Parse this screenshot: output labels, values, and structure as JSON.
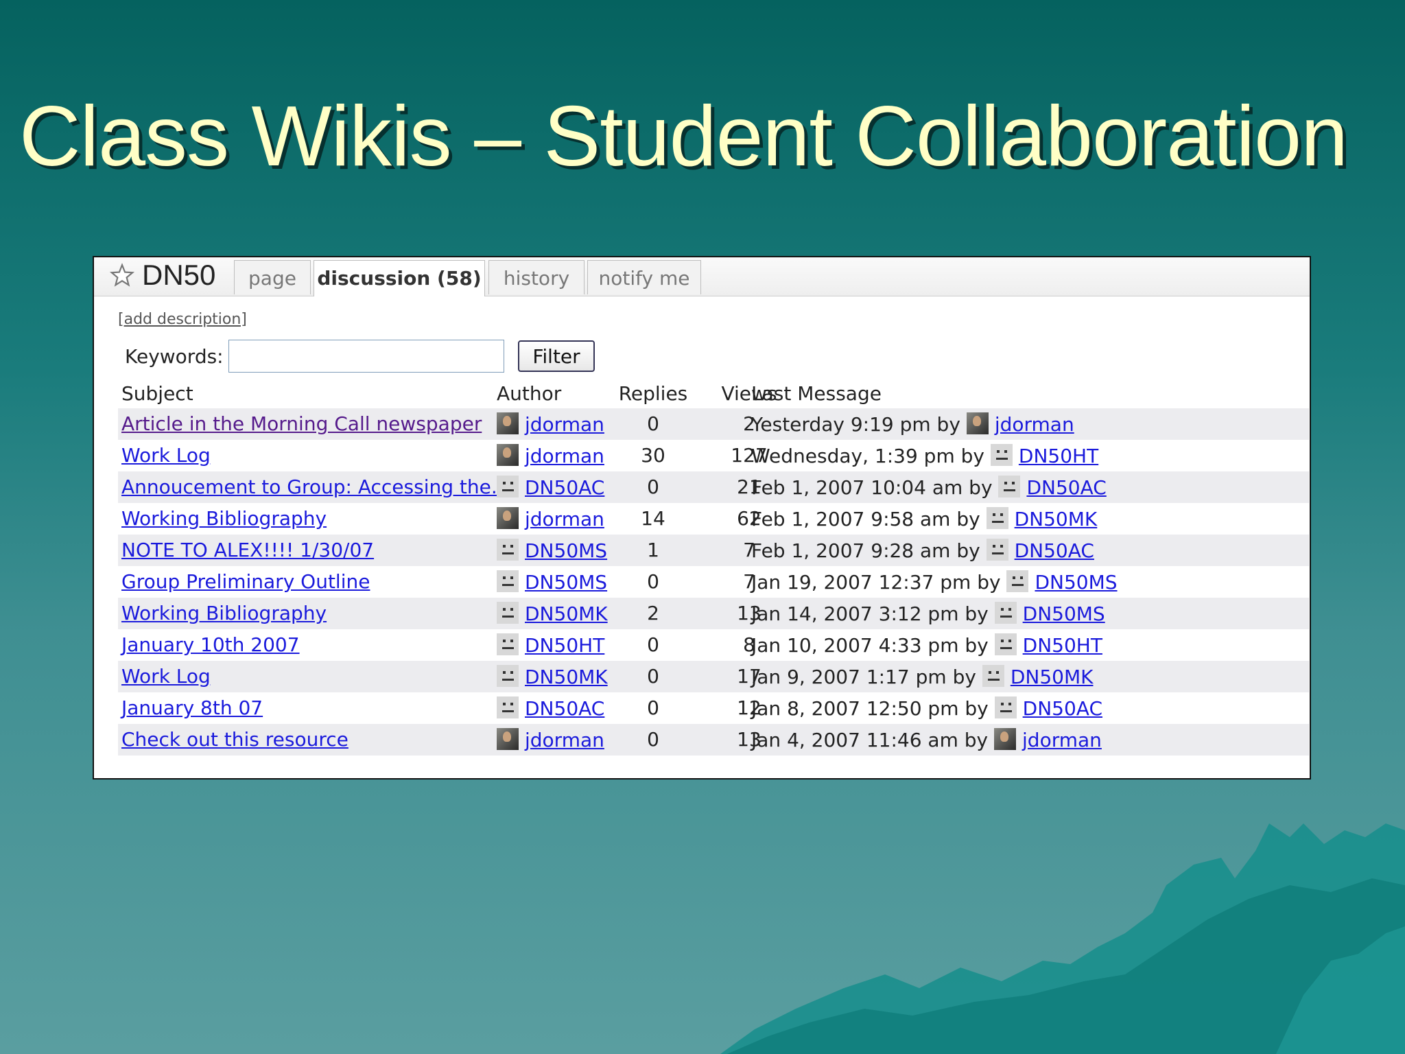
{
  "slide": {
    "title": "Class Wikis – Student Collaboration"
  },
  "wiki": {
    "page_name": "DN50",
    "tabs": [
      {
        "label": "page"
      },
      {
        "label": "discussion (58)"
      },
      {
        "label": "history"
      },
      {
        "label": "notify me"
      }
    ],
    "add_description": "[add description]",
    "filter": {
      "keywords_label": "Keywords:",
      "keywords_value": "",
      "button_label": "Filter"
    },
    "columns": {
      "subject": "Subject",
      "author": "Author",
      "replies": "Replies",
      "views": "Views",
      "last_message": "Last Message"
    },
    "rows": [
      {
        "subject": "Article in the Morning Call newspaper",
        "author": "jdorman",
        "author_avatar": "photo",
        "replies": "0",
        "views": "2",
        "last_time": "Yesterday 9:19 pm by",
        "last_author": "jdorman",
        "last_avatar": "photo",
        "visited": true
      },
      {
        "subject": "Work Log",
        "author": "jdorman",
        "author_avatar": "photo",
        "replies": "30",
        "views": "127",
        "last_time": "Wednesday, 1:39 pm by",
        "last_author": "DN50HT",
        "last_avatar": "face"
      },
      {
        "subject": "Annoucement to Group: Accessing the...",
        "author": "DN50AC",
        "author_avatar": "face",
        "replies": "0",
        "views": "21",
        "last_time": "Feb 1, 2007 10:04 am by",
        "last_author": "DN50AC",
        "last_avatar": "face"
      },
      {
        "subject": "Working Bibliography",
        "author": "jdorman",
        "author_avatar": "photo",
        "replies": "14",
        "views": "62",
        "last_time": "Feb 1, 2007 9:58 am by",
        "last_author": "DN50MK",
        "last_avatar": "face"
      },
      {
        "subject": "NOTE TO ALEX!!!! 1/30/07",
        "author": "DN50MS",
        "author_avatar": "face",
        "replies": "1",
        "views": "7",
        "last_time": "Feb 1, 2007 9:28 am by",
        "last_author": "DN50AC",
        "last_avatar": "face"
      },
      {
        "subject": "Group Preliminary Outline",
        "author": "DN50MS",
        "author_avatar": "face",
        "replies": "0",
        "views": "7",
        "last_time": "Jan 19, 2007 12:37 pm by",
        "last_author": "DN50MS",
        "last_avatar": "face"
      },
      {
        "subject": "Working Bibliography",
        "author": "DN50MK",
        "author_avatar": "face",
        "replies": "2",
        "views": "13",
        "last_time": "Jan 14, 2007 3:12 pm by",
        "last_author": "DN50MS",
        "last_avatar": "face"
      },
      {
        "subject": "January 10th 2007",
        "author": "DN50HT",
        "author_avatar": "face",
        "replies": "0",
        "views": "8",
        "last_time": "Jan 10, 2007 4:33 pm by",
        "last_author": "DN50HT",
        "last_avatar": "face"
      },
      {
        "subject": "Work Log",
        "author": "DN50MK",
        "author_avatar": "face",
        "replies": "0",
        "views": "17",
        "last_time": "Jan 9, 2007 1:17 pm by",
        "last_author": "DN50MK",
        "last_avatar": "face"
      },
      {
        "subject": "January 8th 07",
        "author": "DN50AC",
        "author_avatar": "face",
        "replies": "0",
        "views": "12",
        "last_time": "Jan 8, 2007 12:50 pm by",
        "last_author": "DN50AC",
        "last_avatar": "face"
      },
      {
        "subject": "Check out this resource",
        "author": "jdorman",
        "author_avatar": "photo",
        "replies": "0",
        "views": "13",
        "last_time": "Jan 4, 2007 11:46 am by",
        "last_author": "jdorman",
        "last_avatar": "photo"
      }
    ]
  },
  "colors": {
    "title": "#ffffc6",
    "link": "#1a1adc",
    "visited_link": "#551a8b",
    "row_shade": "#ececef"
  }
}
